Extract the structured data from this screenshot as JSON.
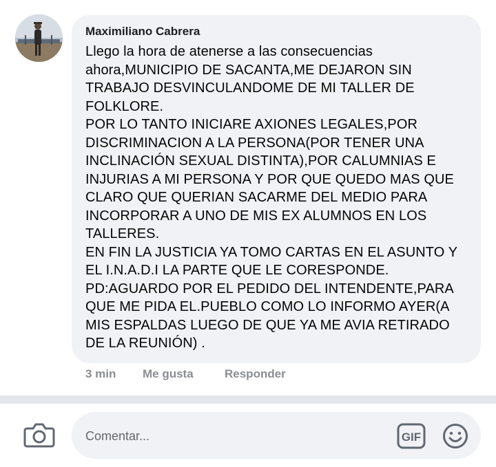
{
  "comment": {
    "author": "Maximiliano Cabrera",
    "text": "Llego la hora de atenerse a las consecuencias\nahora,MUNICIPIO DE SACANTA,ME DEJARON SIN\nTRABAJO DESVINCULANDOME DE MI TALLER DE\nFOLKLORE.\nPOR LO TANTO INICIARE AXIONES LEGALES,POR\nDISCRIMINACION A LA PERSONA(POR TENER UNA\nINCLINACIÓN SEXUAL DISTINTA),POR CALUMNIAS E\nINJURIAS A MI PERSONA Y POR QUE QUEDO MAS QUE\nCLARO QUE QUERIAN SACARME DEL MEDIO PARA\nINCORPORAR A UNO DE MIS EX ALUMNOS EN LOS\nTALLERES.\nEN FIN LA JUSTICIA YA TOMO CARTAS EN EL ASUNTO Y\nEL I.N.A.D.I LA PARTE QUE LE CORESPONDE.\nPD:AGUARDO POR EL PEDIDO DEL INTENDENTE,PARA\nQUE ME PIDA EL.PUEBLO COMO LO INFORMO AYER(A\nMIS ESPALDAS LUEGO DE QUE YA ME AVIA RETIRADO\nDE LA REUNIÓN) .",
    "time": "3 min",
    "like_label": "Me gusta",
    "reply_label": "Responder"
  },
  "composer": {
    "placeholder": "Comentar...",
    "camera_icon": "camera-icon",
    "gif_icon": "gif-icon",
    "gif_label": "GIF",
    "emoji_icon": "emoji-icon"
  },
  "colors": {
    "bubble_bg": "#f0f2f5",
    "meta_text": "#8a8d91",
    "divider": "#e4e6eb"
  }
}
